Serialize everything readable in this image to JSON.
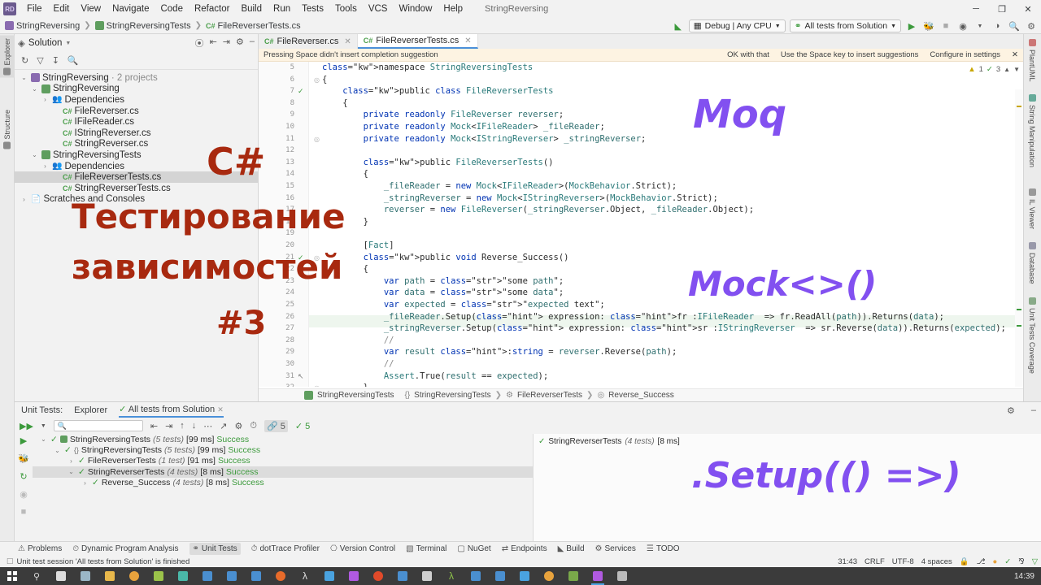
{
  "app": {
    "window_title": "StringReversing",
    "menu": [
      "File",
      "Edit",
      "View",
      "Navigate",
      "Code",
      "Refactor",
      "Build",
      "Run",
      "Tests",
      "Tools",
      "VCS",
      "Window",
      "Help"
    ],
    "window_controls": {
      "minimize": "─",
      "maximize": "❐",
      "close": "✕"
    }
  },
  "toolbar": {
    "breadcrumbs": [
      {
        "icon": "solution-icon",
        "label": "StringReversing"
      },
      {
        "icon": "project-icon",
        "label": "StringReversingTests"
      },
      {
        "icon": "csharp-file-icon",
        "label": "FileReverserTests.cs"
      }
    ],
    "build_config": "Debug | Any CPU",
    "run_config": "All tests from Solution",
    "buttons": [
      "hammer-icon",
      "run-icon",
      "debug-icon",
      "stop-icon",
      "coverage-run-icon",
      "profile-run-icon",
      "search-everywhere-icon",
      "settings-icon"
    ]
  },
  "left_strip": [
    {
      "label": "Explorer",
      "selected": true
    },
    {
      "label": "Structure",
      "selected": false
    }
  ],
  "right_strip": [
    {
      "label": "PlantUML"
    },
    {
      "label": "String Manipulation"
    },
    {
      "label": "IL Viewer"
    },
    {
      "label": "Database"
    },
    {
      "label": "Unit Tests Coverage"
    }
  ],
  "solution": {
    "title": "Solution",
    "toolbar_icons": [
      "sync-icon",
      "filter-icon",
      "collapse-icon",
      "search-icon"
    ],
    "header_icons": [
      "locate-icon",
      "expand-all-icon",
      "collapse-all-icon",
      "gear-icon",
      "minimize-icon"
    ],
    "tree": [
      {
        "indent": 0,
        "twisty": "⌄",
        "icon": "solution-icon",
        "label": "StringReversing",
        "suffix": " · 2 projects",
        "selected": false
      },
      {
        "indent": 1,
        "twisty": "⌄",
        "icon": "project-icon",
        "label": "StringReversing",
        "suffix": "",
        "selected": false
      },
      {
        "indent": 2,
        "twisty": "›",
        "icon": "dependencies-icon",
        "label": "Dependencies",
        "suffix": "",
        "selected": false
      },
      {
        "indent": 3,
        "twisty": "",
        "icon": "csharp-file-icon",
        "label": "FileReverser.cs",
        "suffix": "",
        "selected": false
      },
      {
        "indent": 3,
        "twisty": "",
        "icon": "csharp-file-icon",
        "label": "IFileReader.cs",
        "suffix": "",
        "selected": false
      },
      {
        "indent": 3,
        "twisty": "",
        "icon": "csharp-file-icon",
        "label": "IStringReverser.cs",
        "suffix": "",
        "selected": false
      },
      {
        "indent": 3,
        "twisty": "",
        "icon": "csharp-file-icon",
        "label": "StringReverser.cs",
        "suffix": "",
        "selected": false
      },
      {
        "indent": 1,
        "twisty": "⌄",
        "icon": "project-icon",
        "label": "StringReversingTests",
        "suffix": "",
        "selected": false
      },
      {
        "indent": 2,
        "twisty": "›",
        "icon": "dependencies-icon",
        "label": "Dependencies",
        "suffix": "",
        "selected": false
      },
      {
        "indent": 3,
        "twisty": "",
        "icon": "csharp-file-icon",
        "label": "FileReverserTests.cs",
        "suffix": "",
        "selected": true
      },
      {
        "indent": 3,
        "twisty": "",
        "icon": "csharp-file-icon",
        "label": "StringReverserTests.cs",
        "suffix": "",
        "selected": false
      },
      {
        "indent": 0,
        "twisty": "›",
        "icon": "scratches-icon",
        "label": "Scratches and Consoles",
        "suffix": "",
        "selected": false
      }
    ]
  },
  "editor": {
    "tabs": [
      {
        "label": "FileReverser.cs",
        "active": false
      },
      {
        "label": "FileReverserTests.cs",
        "active": true
      }
    ],
    "notification": {
      "message": "Pressing Space didn't insert completion suggestion",
      "actions": [
        "OK with that",
        "Use the Space key to insert suggestions",
        "Configure in settings"
      ],
      "close": "✕"
    },
    "inspection": {
      "warnings": "1",
      "oks": "3"
    },
    "breadcrumb": [
      "StringReversingTests",
      "StringReversingTests",
      "FileReverserTests",
      "Reverse_Success"
    ],
    "lines": [
      {
        "n": "5",
        "mark": "",
        "text": "namespace StringReversingTests"
      },
      {
        "n": "6",
        "mark": "",
        "text": "{"
      },
      {
        "n": "7",
        "mark": "test-ok",
        "text": "    public class FileReverserTests"
      },
      {
        "n": "8",
        "mark": "",
        "text": "    {"
      },
      {
        "n": "9",
        "mark": "",
        "text": "        private readonly FileReverser reverser;"
      },
      {
        "n": "10",
        "mark": "",
        "text": "        private readonly Mock<IFileReader> _fileReader;"
      },
      {
        "n": "11",
        "mark": "",
        "text": "        private readonly Mock<IStringReverser> _stringReverser;"
      },
      {
        "n": "12",
        "mark": "",
        "text": ""
      },
      {
        "n": "13",
        "mark": "",
        "text": "        public FileReverserTests()"
      },
      {
        "n": "14",
        "mark": "",
        "text": "        {"
      },
      {
        "n": "15",
        "mark": "",
        "text": "            _fileReader = new Mock<IFileReader>(MockBehavior.Strict);"
      },
      {
        "n": "16",
        "mark": "",
        "text": "            _stringReverser = new Mock<IStringReverser>(MockBehavior.Strict);"
      },
      {
        "n": "17",
        "mark": "",
        "text": "            reverser = new FileReverser(_stringReverser.Object, _fileReader.Object);"
      },
      {
        "n": "18",
        "mark": "",
        "text": "        }"
      },
      {
        "n": "19",
        "mark": "",
        "text": ""
      },
      {
        "n": "20",
        "mark": "",
        "text": "        [Fact]"
      },
      {
        "n": "21",
        "mark": "test-ok",
        "text": "        public void Reverse_Success()"
      },
      {
        "n": "22",
        "mark": "",
        "text": "        {"
      },
      {
        "n": "23",
        "mark": "",
        "text": "            var path = \"some path\";"
      },
      {
        "n": "24",
        "mark": "",
        "text": "            var data = \"some data\";"
      },
      {
        "n": "25",
        "mark": "",
        "text": "            var expected = \"expected text\";"
      },
      {
        "n": "26",
        "mark": "",
        "text": "            _fileReader.Setup( expression: fr :IFileReader  => fr.ReadAll(path)).Returns(data);"
      },
      {
        "n": "27",
        "mark": "",
        "text": "            _stringReverser.Setup( expression: sr :IStringReverser  => sr.Reverse(data)).Returns(expected);"
      },
      {
        "n": "28",
        "mark": "",
        "text": "            //"
      },
      {
        "n": "29",
        "mark": "",
        "text": "            var result :string = reverser.Reverse(path);"
      },
      {
        "n": "30",
        "mark": "",
        "text": "            //"
      },
      {
        "n": "31",
        "mark": "recent-change",
        "text": "            Assert.True(result == expected);"
      },
      {
        "n": "32",
        "mark": "",
        "text": "        }"
      }
    ]
  },
  "unit_tests": {
    "tabs": [
      {
        "label": "Unit Tests:",
        "type": "title"
      },
      {
        "label": "Explorer",
        "type": "tab"
      },
      {
        "label": "All tests from Solution",
        "type": "tab",
        "active": true,
        "closable": true
      }
    ],
    "toolbar": {
      "search_placeholder": "",
      "search_icon": "search-icon",
      "icons": [
        "expand-all-icon",
        "collapse-all-icon",
        "up-icon",
        "down-icon",
        "group-icon",
        "export-icon",
        "settings-icon",
        "history-icon"
      ],
      "failed_count": "5",
      "passed_count": "5"
    },
    "tree": [
      {
        "indent": 0,
        "twisty": "⌄",
        "icon": "project-icon",
        "label": "StringReversingTests",
        "count": "(5 tests)",
        "time": "[99 ms]",
        "status": "Success",
        "selected": false
      },
      {
        "indent": 1,
        "twisty": "⌄",
        "icon": "namespace-icon",
        "label": "StringReversingTests",
        "count": "(5 tests)",
        "time": "[99 ms]",
        "status": "Success",
        "selected": false
      },
      {
        "indent": 2,
        "twisty": "›",
        "icon": "class-icon",
        "label": "FileReverserTests",
        "count": "(1 test)",
        "time": "[91 ms]",
        "status": "Success",
        "selected": false
      },
      {
        "indent": 2,
        "twisty": "⌄",
        "icon": "class-icon",
        "label": "StringReverserTests",
        "count": "(4 tests)",
        "time": "[8 ms]",
        "status": "Success",
        "selected": true
      },
      {
        "indent": 3,
        "twisty": "›",
        "icon": "method-icon",
        "label": "Reverse_Success",
        "count": "(4 tests)",
        "time": "[8 ms]",
        "status": "Success",
        "selected": false
      }
    ],
    "output": {
      "label": "StringReverserTests",
      "count": "(4 tests)",
      "time": "[8 ms]"
    }
  },
  "bottom_bar": [
    {
      "label": "Problems",
      "icon": "problems-icon",
      "active": false
    },
    {
      "label": "Dynamic Program Analysis",
      "icon": "analysis-icon",
      "active": false
    },
    {
      "label": "Unit Tests",
      "icon": "unit-tests-icon",
      "active": true
    },
    {
      "label": "dotTrace Profiler",
      "icon": "profiler-icon",
      "active": false
    },
    {
      "label": "Version Control",
      "icon": "vcs-icon",
      "active": false
    },
    {
      "label": "Terminal",
      "icon": "terminal-icon",
      "active": false
    },
    {
      "label": "NuGet",
      "icon": "nuget-icon",
      "active": false
    },
    {
      "label": "Endpoints",
      "icon": "endpoints-icon",
      "active": false
    },
    {
      "label": "Build",
      "icon": "build-icon",
      "active": false
    },
    {
      "label": "Services",
      "icon": "services-icon",
      "active": false
    },
    {
      "label": "TODO",
      "icon": "todo-icon",
      "active": false
    }
  ],
  "status_bar": {
    "message": "Unit test session 'All tests from Solution' is finished",
    "caret": "31:43",
    "line_ending": "CRLF",
    "encoding": "UTF-8",
    "indent": "4 spaces",
    "icons": [
      "lock-icon",
      "branch-icon",
      "notifications-icon",
      "inspections-icon",
      "macro-icon",
      "filter-icon"
    ]
  },
  "taskbar": {
    "clock": "14:39",
    "items": [
      {
        "icon": "windows-start-icon",
        "color": "#ffffff"
      },
      {
        "icon": "search-icon",
        "color": "#dddddd"
      },
      {
        "icon": "task-view-icon",
        "color": "#dddddd"
      },
      {
        "icon": "widget-icon",
        "color": "#9bb7c7"
      },
      {
        "icon": "file-explorer-icon",
        "color": "#e8b84b"
      },
      {
        "icon": "anaconda-icon",
        "color": "#e8a33d"
      },
      {
        "icon": "notepad-icon",
        "color": "#9bc34a"
      },
      {
        "icon": "postman-icon",
        "color": "#4ab8a8"
      },
      {
        "icon": "vs-icon",
        "color": "#4a8fd0"
      },
      {
        "icon": "vs2-icon",
        "color": "#4a8fd0"
      },
      {
        "icon": "vs3-icon",
        "color": "#4a8fd0"
      },
      {
        "icon": "firefox-icon",
        "color": "#e86b2a"
      },
      {
        "icon": "lambda-icon",
        "color": "#e0e0e0"
      },
      {
        "icon": "mail-icon",
        "color": "#4aa3e0"
      },
      {
        "icon": "link-icon",
        "color": "#b05ae0"
      },
      {
        "icon": "opera-icon",
        "color": "#e04a2a"
      },
      {
        "icon": "vs4-icon",
        "color": "#4a8fd0"
      },
      {
        "icon": "excel-icon",
        "color": "#cfcfcf"
      },
      {
        "icon": "lambda2-icon",
        "color": "#8ec34a"
      },
      {
        "icon": "vs5-icon",
        "color": "#4a8fd0"
      },
      {
        "icon": "vs6-icon",
        "color": "#4a8fd0"
      },
      {
        "icon": "telegram-icon",
        "color": "#4aa3e0"
      },
      {
        "icon": "chrome-icon",
        "color": "#e8a33d"
      },
      {
        "icon": "resharper-icon",
        "color": "#7aa84a"
      },
      {
        "icon": "rider-icon",
        "color": "#b05ae0",
        "running": true
      },
      {
        "icon": "clock-icon",
        "color": "#bbbbbb"
      }
    ]
  },
  "overlay": {
    "csharp": "C#",
    "line1": "Тестирование",
    "line2": "зависимостей",
    "line3": "#3",
    "moq": "Moq",
    "mock": "Mock<>()",
    "setup": ".Setup(() =>)",
    "colors": {
      "red": "#a8290f",
      "purple": "#8250f0"
    }
  }
}
